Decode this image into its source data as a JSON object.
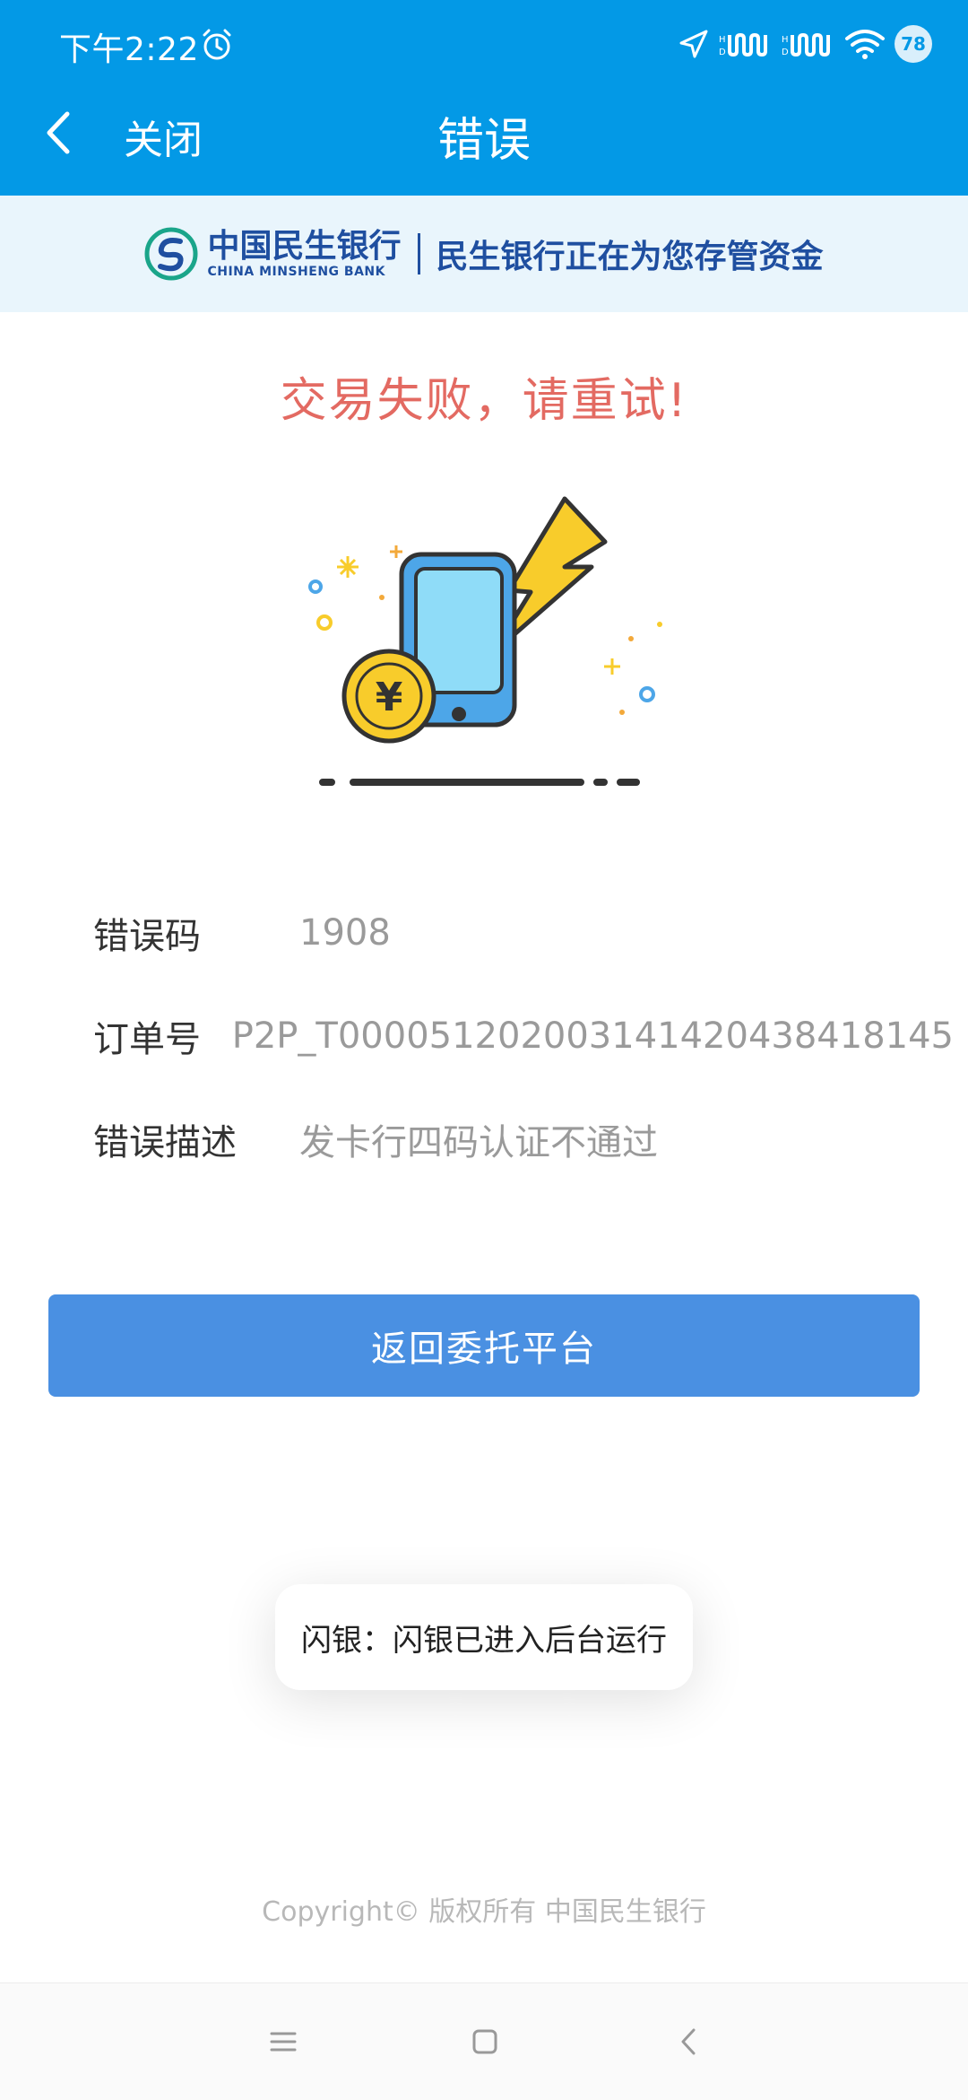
{
  "status_bar": {
    "time": "下午2:22",
    "battery": "78",
    "icons": [
      "alarm-icon",
      "location-icon",
      "hd-signal-icon",
      "hd-signal-icon",
      "wifi-icon",
      "battery-icon"
    ]
  },
  "header": {
    "close_label": "关闭",
    "title": "错误",
    "back_icon": "chevron-left-icon",
    "background_color": "#0399E6"
  },
  "banner": {
    "bank_name_cn": "中国民生银行",
    "bank_name_en": "CHINA MINSHENG BANK",
    "slogan": "民生银行正在为您存管资金",
    "brand_color": "#1F4FA0"
  },
  "result": {
    "title": "交易失败，请重试!",
    "title_color": "#E36A62",
    "illustration": "phone-payment-error-illustration"
  },
  "details": [
    {
      "label": "错误码",
      "value": "1908"
    },
    {
      "label": "订单号",
      "value": "P2P_T000051202003141420438418145"
    },
    {
      "label": "错误描述",
      "value": "发卡行四码认证不通过"
    }
  ],
  "return_button": {
    "label": "返回委托平台",
    "color": "#4A90E2"
  },
  "toast": {
    "text": "闪银：闪银已进入后台运行"
  },
  "footer": {
    "copyright": "Copyright© 版权所有 中国民生银行"
  },
  "system_nav": {
    "items": [
      "menu-icon",
      "home-icon",
      "back-icon"
    ]
  }
}
